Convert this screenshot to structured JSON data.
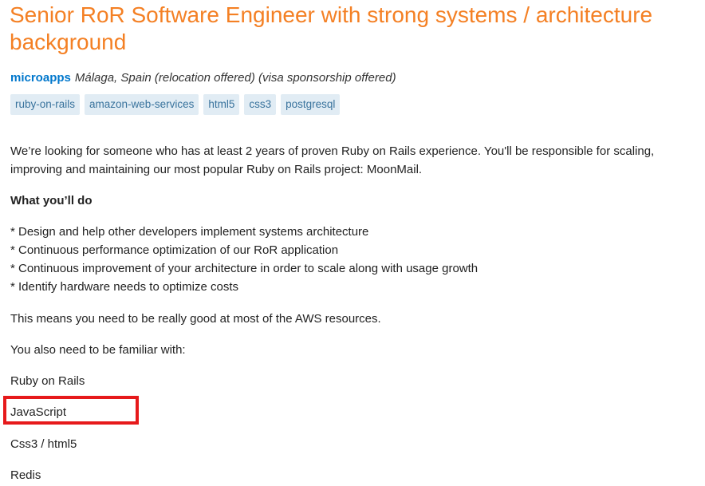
{
  "job": {
    "title": "Senior RoR Software Engineer with strong systems / architecture background",
    "company": "microapps",
    "location": "Málaga, Spain (relocation offered) (visa sponsorship offered)",
    "tags": [
      "ruby-on-rails",
      "amazon-web-services",
      "html5",
      "css3",
      "postgresql"
    ]
  },
  "description": {
    "intro": "We’re looking for someone who has at least 2 years of proven Ruby on Rails experience. You'll be responsible for scaling, improving and maintaining our most popular Ruby on Rails project: MoonMail.",
    "what_heading": "What you’ll do",
    "bullets": [
      "* Design and help other developers implement systems architecture",
      "* Continuous performance optimization of our RoR application",
      "* Continuous improvement of your architecture in order to scale along with usage growth",
      "* Identify hardware needs to optimize costs"
    ],
    "aws_text": "This means you need to be really good at most of the AWS resources.",
    "familiar_text": "You also need to be familiar with:",
    "skills": [
      "Ruby on Rails",
      "JavaScript",
      "Css3 / html5",
      "Redis"
    ]
  },
  "annotation": {
    "highlight_color": "#e6191b"
  },
  "colors": {
    "title": "#f48024",
    "company_link": "#0077cc",
    "tag_bg": "#e1ecf4",
    "tag_text": "#39739d"
  }
}
